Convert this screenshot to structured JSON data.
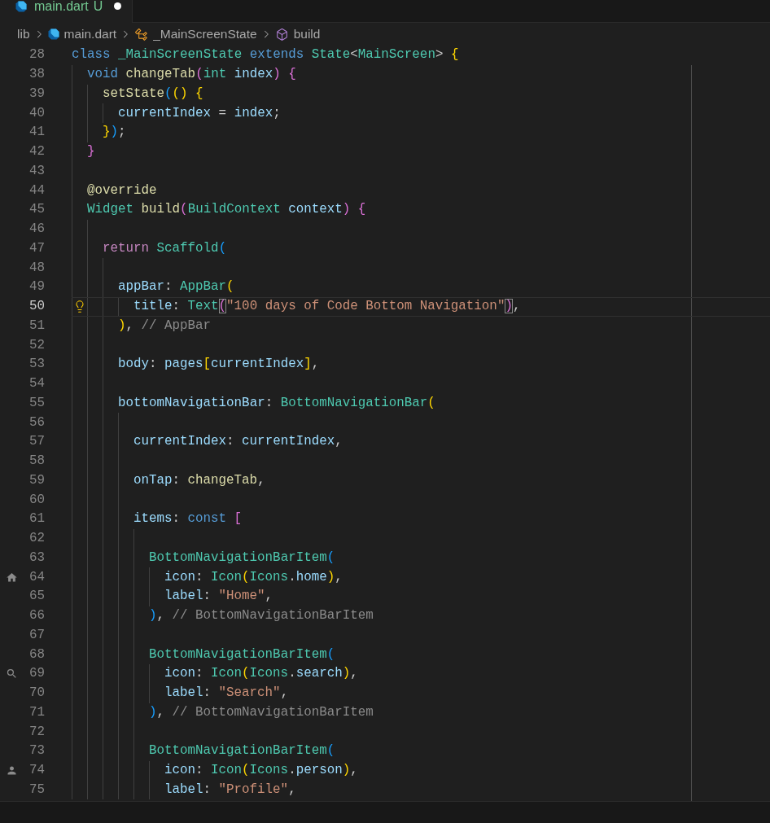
{
  "tabs": [
    {
      "file_name": "main.dart",
      "git_status": "U",
      "modified": true,
      "selected": true
    }
  ],
  "breadcrumbs": [
    {
      "label": "lib",
      "kind": "folder"
    },
    {
      "label": "main.dart",
      "kind": "file"
    },
    {
      "label": "_MainScreenState",
      "kind": "class"
    },
    {
      "label": "build",
      "kind": "method"
    }
  ],
  "editor": {
    "lines": [
      {
        "number": "28",
        "current": false,
        "tokens": [
          {
            "text": "class ",
            "kind": "keyword"
          },
          {
            "text": "_MainScreenState ",
            "kind": "type"
          },
          {
            "text": "extends ",
            "kind": "keyword"
          },
          {
            "text": "State",
            "kind": "type"
          },
          {
            "text": "<",
            "kind": "punct"
          },
          {
            "text": "MainScreen",
            "kind": "type"
          },
          {
            "text": "> ",
            "kind": "punct"
          },
          {
            "text": "{",
            "kind": "bracket1"
          }
        ],
        "children": [
          {
            "number": "38",
            "current": false,
            "tokens": [
              {
                "text": "void ",
                "kind": "keyword"
              },
              {
                "text": "changeTab",
                "kind": "function"
              },
              {
                "text": "(",
                "kind": "bracket2"
              },
              {
                "text": "int ",
                "kind": "type"
              },
              {
                "text": "index",
                "kind": "variable"
              },
              {
                "text": ") {",
                "kind": "bracket2"
              }
            ],
            "children": [
              {
                "number": "39",
                "current": false,
                "tokens": [
                  {
                    "text": "setState",
                    "kind": "function"
                  },
                  {
                    "text": "(",
                    "kind": "bracket3"
                  },
                  {
                    "text": "() {",
                    "kind": "bracket1"
                  }
                ],
                "children": [
                  {
                    "number": "40",
                    "current": false,
                    "tokens": [
                      {
                        "text": "currentIndex",
                        "kind": "variable"
                      },
                      {
                        "text": " = ",
                        "kind": "punct"
                      },
                      {
                        "text": "index",
                        "kind": "variable"
                      },
                      {
                        "text": ";",
                        "kind": "punct"
                      }
                    ]
                  }
                ]
              },
              {
                "number": "41",
                "current": false,
                "tokens": [
                  {
                    "text": "}",
                    "kind": "bracket1"
                  },
                  {
                    "text": ")",
                    "kind": "bracket3"
                  },
                  {
                    "text": ";",
                    "kind": "punct"
                  }
                ]
              }
            ]
          },
          {
            "number": "42",
            "current": false,
            "tokens": [
              {
                "text": "}",
                "kind": "bracket2"
              }
            ]
          },
          {
            "number": "43",
            "current": false
          },
          {
            "number": "44",
            "current": false,
            "tokens": [
              {
                "text": "@override",
                "kind": "annotation"
              }
            ]
          },
          {
            "number": "45",
            "current": false,
            "tokens": [
              {
                "text": "Widget ",
                "kind": "type"
              },
              {
                "text": "build",
                "kind": "function"
              },
              {
                "text": "(",
                "kind": "bracket2"
              },
              {
                "text": "BuildContext ",
                "kind": "type"
              },
              {
                "text": "context",
                "kind": "variable"
              },
              {
                "text": ") {",
                "kind": "bracket2"
              }
            ],
            "children": [
              {
                "number": "46",
                "current": false
              },
              {
                "number": "47",
                "current": false,
                "tokens": [
                  {
                    "text": "return ",
                    "kind": "control"
                  },
                  {
                    "text": "Scaffold",
                    "kind": "type"
                  },
                  {
                    "text": "(",
                    "kind": "bracket3"
                  }
                ],
                "children": [
                  {
                    "number": "48",
                    "current": false
                  },
                  {
                    "number": "49",
                    "current": false,
                    "tokens": [
                      {
                        "text": "appBar",
                        "kind": "variable"
                      },
                      {
                        "text": ": ",
                        "kind": "punct"
                      },
                      {
                        "text": "AppBar",
                        "kind": "type"
                      },
                      {
                        "text": "(",
                        "kind": "bracket1"
                      }
                    ],
                    "children": [
                      {
                        "number": "50",
                        "current": true,
                        "gutter_icon": {
                          "kind": "lightbulb"
                        },
                        "tokens": [
                          {
                            "text": "title",
                            "kind": "variable"
                          },
                          {
                            "text": ": ",
                            "kind": "punct"
                          },
                          {
                            "text": "Text",
                            "kind": "type"
                          },
                          {
                            "text": "(",
                            "kind": "bracket2",
                            "matched": true
                          },
                          {
                            "text": "\"100 days of Code Bottom Navigation\"",
                            "kind": "string"
                          },
                          {
                            "text": ")",
                            "kind": "bracket2",
                            "matched": true
                          },
                          {
                            "text": ",",
                            "kind": "punct"
                          }
                        ]
                      }
                    ]
                  },
                  {
                    "number": "51",
                    "current": false,
                    "tokens": [
                      {
                        "text": ")",
                        "kind": "bracket1"
                      },
                      {
                        "text": ", ",
                        "kind": "punct"
                      },
                      {
                        "text": "// AppBar",
                        "kind": "label"
                      }
                    ]
                  },
                  {
                    "number": "52",
                    "current": false
                  },
                  {
                    "number": "53",
                    "current": false,
                    "tokens": [
                      {
                        "text": "body",
                        "kind": "variable"
                      },
                      {
                        "text": ": ",
                        "kind": "punct"
                      },
                      {
                        "text": "pages",
                        "kind": "variable"
                      },
                      {
                        "text": "[",
                        "kind": "bracket1"
                      },
                      {
                        "text": "currentIndex",
                        "kind": "variable"
                      },
                      {
                        "text": "]",
                        "kind": "bracket1"
                      },
                      {
                        "text": ",",
                        "kind": "punct"
                      }
                    ]
                  },
                  {
                    "number": "54",
                    "current": false
                  },
                  {
                    "number": "55",
                    "current": false,
                    "tokens": [
                      {
                        "text": "bottomNavigationBar",
                        "kind": "variable"
                      },
                      {
                        "text": ": ",
                        "kind": "punct"
                      },
                      {
                        "text": "BottomNavigationBar",
                        "kind": "type"
                      },
                      {
                        "text": "(",
                        "kind": "bracket1"
                      }
                    ],
                    "children": [
                      {
                        "number": "56",
                        "current": false
                      },
                      {
                        "number": "57",
                        "current": false,
                        "tokens": [
                          {
                            "text": "currentIndex",
                            "kind": "variable"
                          },
                          {
                            "text": ": ",
                            "kind": "punct"
                          },
                          {
                            "text": "currentIndex",
                            "kind": "variable"
                          },
                          {
                            "text": ",",
                            "kind": "punct"
                          }
                        ]
                      },
                      {
                        "number": "58",
                        "current": false
                      },
                      {
                        "number": "59",
                        "current": false,
                        "tokens": [
                          {
                            "text": "onTap",
                            "kind": "variable"
                          },
                          {
                            "text": ": ",
                            "kind": "punct"
                          },
                          {
                            "text": "changeTab",
                            "kind": "function"
                          },
                          {
                            "text": ",",
                            "kind": "punct"
                          }
                        ]
                      },
                      {
                        "number": "60",
                        "current": false
                      },
                      {
                        "number": "61",
                        "current": false,
                        "tokens": [
                          {
                            "text": "items",
                            "kind": "variable"
                          },
                          {
                            "text": ": ",
                            "kind": "punct"
                          },
                          {
                            "text": "const ",
                            "kind": "keyword"
                          },
                          {
                            "text": "[",
                            "kind": "bracket2"
                          }
                        ],
                        "children": [
                          {
                            "number": "62",
                            "current": false
                          },
                          {
                            "number": "63",
                            "current": false,
                            "tokens": [
                              {
                                "text": "BottomNavigationBarItem",
                                "kind": "type"
                              },
                              {
                                "text": "(",
                                "kind": "bracket3"
                              }
                            ],
                            "children": [
                              {
                                "number": "64",
                                "current": false,
                                "gutter_icon": {
                                  "kind": "home"
                                },
                                "tokens": [
                                  {
                                    "text": "icon",
                                    "kind": "variable"
                                  },
                                  {
                                    "text": ": ",
                                    "kind": "punct"
                                  },
                                  {
                                    "text": "Icon",
                                    "kind": "type"
                                  },
                                  {
                                    "text": "(",
                                    "kind": "bracket1"
                                  },
                                  {
                                    "text": "Icons",
                                    "kind": "type"
                                  },
                                  {
                                    "text": ".",
                                    "kind": "punct"
                                  },
                                  {
                                    "text": "home",
                                    "kind": "variable"
                                  },
                                  {
                                    "text": ")",
                                    "kind": "bracket1"
                                  },
                                  {
                                    "text": ",",
                                    "kind": "punct"
                                  }
                                ]
                              },
                              {
                                "number": "65",
                                "current": false,
                                "tokens": [
                                  {
                                    "text": "label",
                                    "kind": "variable"
                                  },
                                  {
                                    "text": ": ",
                                    "kind": "punct"
                                  },
                                  {
                                    "text": "\"Home\"",
                                    "kind": "string"
                                  },
                                  {
                                    "text": ",",
                                    "kind": "punct"
                                  }
                                ]
                              }
                            ]
                          },
                          {
                            "number": "66",
                            "current": false,
                            "tokens": [
                              {
                                "text": ")",
                                "kind": "bracket3"
                              },
                              {
                                "text": ", ",
                                "kind": "punct"
                              },
                              {
                                "text": "// BottomNavigationBarItem",
                                "kind": "label"
                              }
                            ]
                          },
                          {
                            "number": "67",
                            "current": false
                          },
                          {
                            "number": "68",
                            "current": false,
                            "tokens": [
                              {
                                "text": "BottomNavigationBarItem",
                                "kind": "type"
                              },
                              {
                                "text": "(",
                                "kind": "bracket3"
                              }
                            ],
                            "children": [
                              {
                                "number": "69",
                                "current": false,
                                "gutter_icon": {
                                  "kind": "search"
                                },
                                "tokens": [
                                  {
                                    "text": "icon",
                                    "kind": "variable"
                                  },
                                  {
                                    "text": ": ",
                                    "kind": "punct"
                                  },
                                  {
                                    "text": "Icon",
                                    "kind": "type"
                                  },
                                  {
                                    "text": "(",
                                    "kind": "bracket1"
                                  },
                                  {
                                    "text": "Icons",
                                    "kind": "type"
                                  },
                                  {
                                    "text": ".",
                                    "kind": "punct"
                                  },
                                  {
                                    "text": "search",
                                    "kind": "variable"
                                  },
                                  {
                                    "text": ")",
                                    "kind": "bracket1"
                                  },
                                  {
                                    "text": ",",
                                    "kind": "punct"
                                  }
                                ]
                              },
                              {
                                "number": "70",
                                "current": false,
                                "tokens": [
                                  {
                                    "text": "label",
                                    "kind": "variable"
                                  },
                                  {
                                    "text": ": ",
                                    "kind": "punct"
                                  },
                                  {
                                    "text": "\"Search\"",
                                    "kind": "string"
                                  },
                                  {
                                    "text": ",",
                                    "kind": "punct"
                                  }
                                ]
                              }
                            ]
                          },
                          {
                            "number": "71",
                            "current": false,
                            "tokens": [
                              {
                                "text": ")",
                                "kind": "bracket3"
                              },
                              {
                                "text": ", ",
                                "kind": "punct"
                              },
                              {
                                "text": "// BottomNavigationBarItem",
                                "kind": "label"
                              }
                            ]
                          },
                          {
                            "number": "72",
                            "current": false
                          },
                          {
                            "number": "73",
                            "current": false,
                            "tokens": [
                              {
                                "text": "BottomNavigationBarItem",
                                "kind": "type"
                              },
                              {
                                "text": "(",
                                "kind": "bracket3"
                              }
                            ],
                            "children": [
                              {
                                "number": "74",
                                "current": false,
                                "gutter_icon": {
                                  "kind": "person"
                                },
                                "tokens": [
                                  {
                                    "text": "icon",
                                    "kind": "variable"
                                  },
                                  {
                                    "text": ": ",
                                    "kind": "punct"
                                  },
                                  {
                                    "text": "Icon",
                                    "kind": "type"
                                  },
                                  {
                                    "text": "(",
                                    "kind": "bracket1"
                                  },
                                  {
                                    "text": "Icons",
                                    "kind": "type"
                                  },
                                  {
                                    "text": ".",
                                    "kind": "punct"
                                  },
                                  {
                                    "text": "person",
                                    "kind": "variable"
                                  },
                                  {
                                    "text": ")",
                                    "kind": "bracket1"
                                  },
                                  {
                                    "text": ",",
                                    "kind": "punct"
                                  }
                                ]
                              },
                              {
                                "number": "75",
                                "current": false,
                                "tokens": [
                                  {
                                    "text": "label",
                                    "kind": "variable"
                                  },
                                  {
                                    "text": ": ",
                                    "kind": "punct"
                                  },
                                  {
                                    "text": "\"Profile\"",
                                    "kind": "string"
                                  },
                                  {
                                    "text": ",",
                                    "kind": "punct"
                                  }
                                ]
                              }
                            ]
                          }
                        ]
                      }
                    ]
                  }
                ]
              }
            ]
          }
        ]
      }
    ]
  }
}
